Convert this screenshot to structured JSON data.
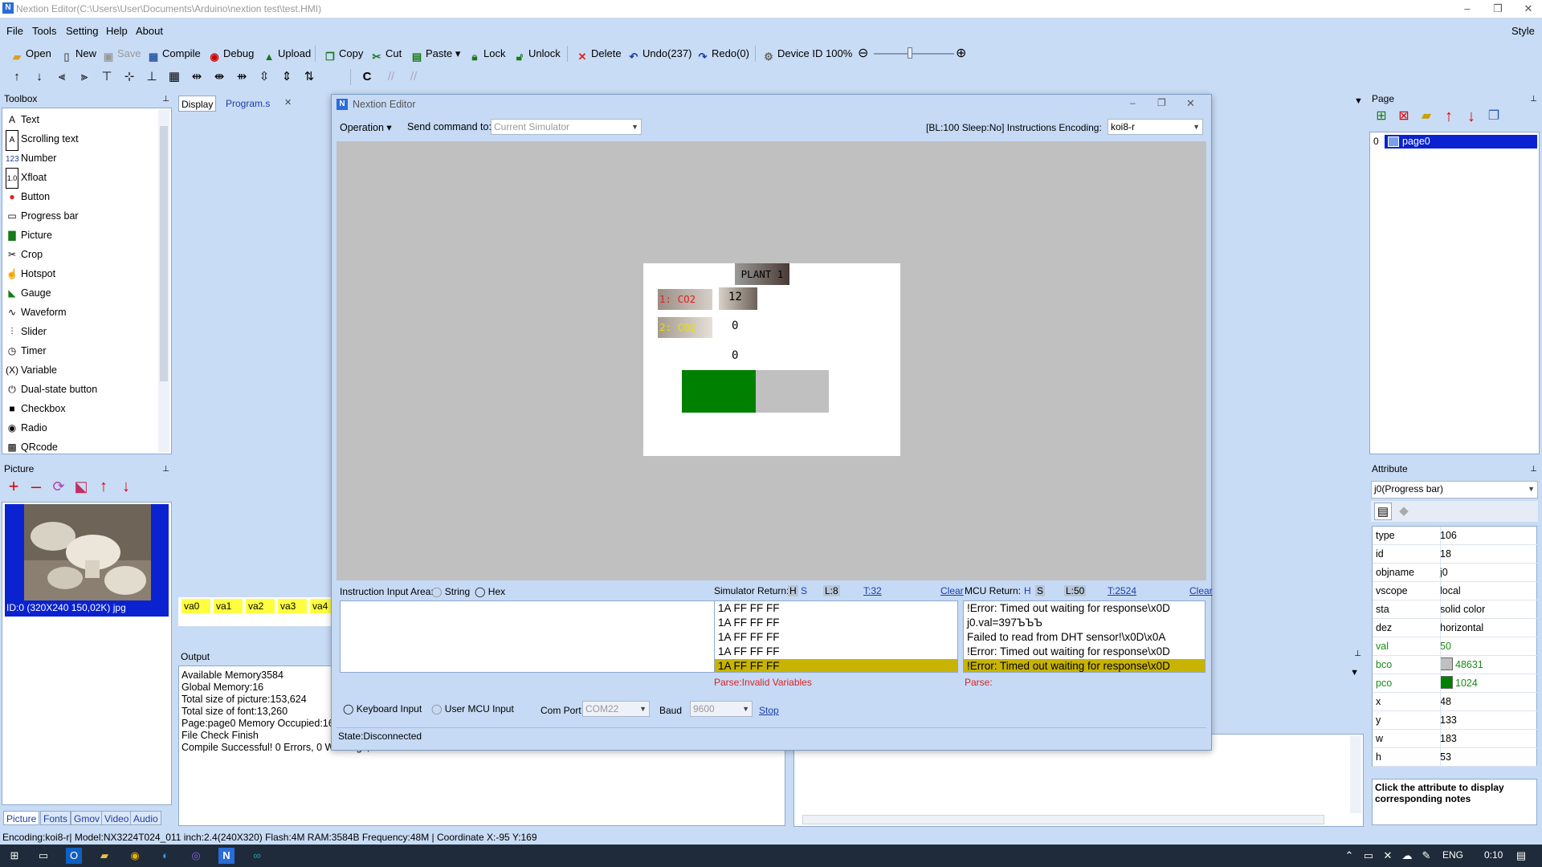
{
  "window": {
    "title": "Nextion Editor(C:\\Users\\User\\Documents\\Arduino\\nextion test\\test.HMI)",
    "style": "Style"
  },
  "menu": [
    "File",
    "Tools",
    "Setting",
    "Help",
    "About"
  ],
  "toolbar": {
    "open": "Open",
    "new": "New",
    "save": "Save",
    "compile": "Compile",
    "debug": "Debug",
    "upload": "Upload",
    "copy": "Copy",
    "cut": "Cut",
    "paste": "Paste",
    "lock": "Lock",
    "unlock": "Unlock",
    "delete": "Delete",
    "undo": "Undo(237)",
    "redo": "Redo(0)",
    "device_id": "Device ID",
    "zoom": "100%"
  },
  "toolbox": {
    "title": "Toolbox",
    "items": [
      "Text",
      "Scrolling text",
      "Number",
      "Xfloat",
      "Button",
      "Progress bar",
      "Picture",
      "Crop",
      "Hotspot",
      "Gauge",
      "Waveform",
      "Slider",
      "Timer",
      "Variable",
      "Dual-state button",
      "Checkbox",
      "Radio",
      "QRcode"
    ]
  },
  "picture_panel": {
    "title": "Picture",
    "caption": "ID:0  (320X240 150,02K) jpg",
    "tabs": [
      "Picture",
      "Fonts",
      "Gmov",
      "Video",
      "Audio"
    ]
  },
  "doc_tabs": [
    "Display",
    "Program.s"
  ],
  "variables": [
    "va0",
    "va1",
    "va2",
    "va3",
    "va4"
  ],
  "output": {
    "title": "Output",
    "lines": [
      "Available Memory3584",
      "Global Memory:16",
      "Total size of picture:153,624",
      "Total size of font:13,260",
      "Page:page0 Memory Occupied:16",
      "File Check Finish",
      "Compile Successful! 0 Errors, 0 Warnings,"
    ]
  },
  "page_panel": {
    "title": "Page",
    "page_index": "0",
    "page_name": "page0"
  },
  "attribute": {
    "title": "Attribute",
    "selected": "j0(Progress bar)",
    "rows": [
      {
        "k": "type",
        "v": "106"
      },
      {
        "k": "id",
        "v": "18"
      },
      {
        "k": "objname",
        "v": "j0"
      },
      {
        "k": "vscope",
        "v": "local"
      },
      {
        "k": "sta",
        "v": "solid color"
      },
      {
        "k": "dez",
        "v": "horizontal"
      },
      {
        "k": "val",
        "v": "50"
      },
      {
        "k": "bco",
        "v": "48631"
      },
      {
        "k": "pco",
        "v": "1024"
      },
      {
        "k": "x",
        "v": "48"
      },
      {
        "k": "y",
        "v": "133"
      },
      {
        "k": "w",
        "v": "183"
      },
      {
        "k": "h",
        "v": "53"
      }
    ],
    "note": "Click the attribute to display corresponding notes"
  },
  "dialog": {
    "title": "Nextion Editor",
    "operation": "Operation",
    "send_label": "Send command to:",
    "send_target": "Current Simulator",
    "status": "[BL:100  Sleep:No] Instructions Encoding:",
    "encoding": "koi8-r",
    "screen": {
      "title": "PLANT 1",
      "co2_1": "1: CO2",
      "co2_2": "2: CO2",
      "n1": "12",
      "n2": "0",
      "n3": "0",
      "progress_val": 50
    },
    "input_label": "Instruction Input Area:",
    "string": "String",
    "hex": "Hex",
    "sim": {
      "label": "Simulator Return:",
      "h": "H",
      "s": "S",
      "l": "L:8",
      "t": "T:32",
      "clear": "Clear",
      "lines": [
        "1A FF FF FF",
        "1A FF FF FF",
        "1A FF FF FF",
        "1A FF FF FF",
        "1A FF FF FF"
      ],
      "parse": "Parse:Invalid Variables"
    },
    "mcu": {
      "label": "MCU Return:",
      "h": "H",
      "s": "S",
      "l": "L:50",
      "t": "T:2524",
      "clear": "Clear",
      "lines": [
        "!Error: Timed out waiting for response\\x0D",
        "j0.val=397ЪЪЪ",
        "Failed to read from DHT sensor!\\x0D\\x0A",
        "!Error: Timed out waiting for response\\x0D",
        "!Error: Timed out waiting for response\\x0D"
      ],
      "parse": "Parse:"
    },
    "keyboard": "Keyboard Input",
    "user_mcu": "User MCU Input",
    "com_label": "Com Port",
    "com": "COM22",
    "baud_label": "Baud",
    "baud": "9600",
    "stop": "Stop",
    "state": "State:Disconnected"
  },
  "statusbar": "Encoding:koi8-r| Model:NX3224T024_011 inch:2.4(240X320) Flash:4M RAM:3584B Frequency:48M |    Coordinate X:-95  Y:169",
  "taskbar": {
    "lang": "ENG",
    "time": "0:10"
  },
  "colors": {
    "bco": "#c0c0c0",
    "pco": "#008000"
  }
}
